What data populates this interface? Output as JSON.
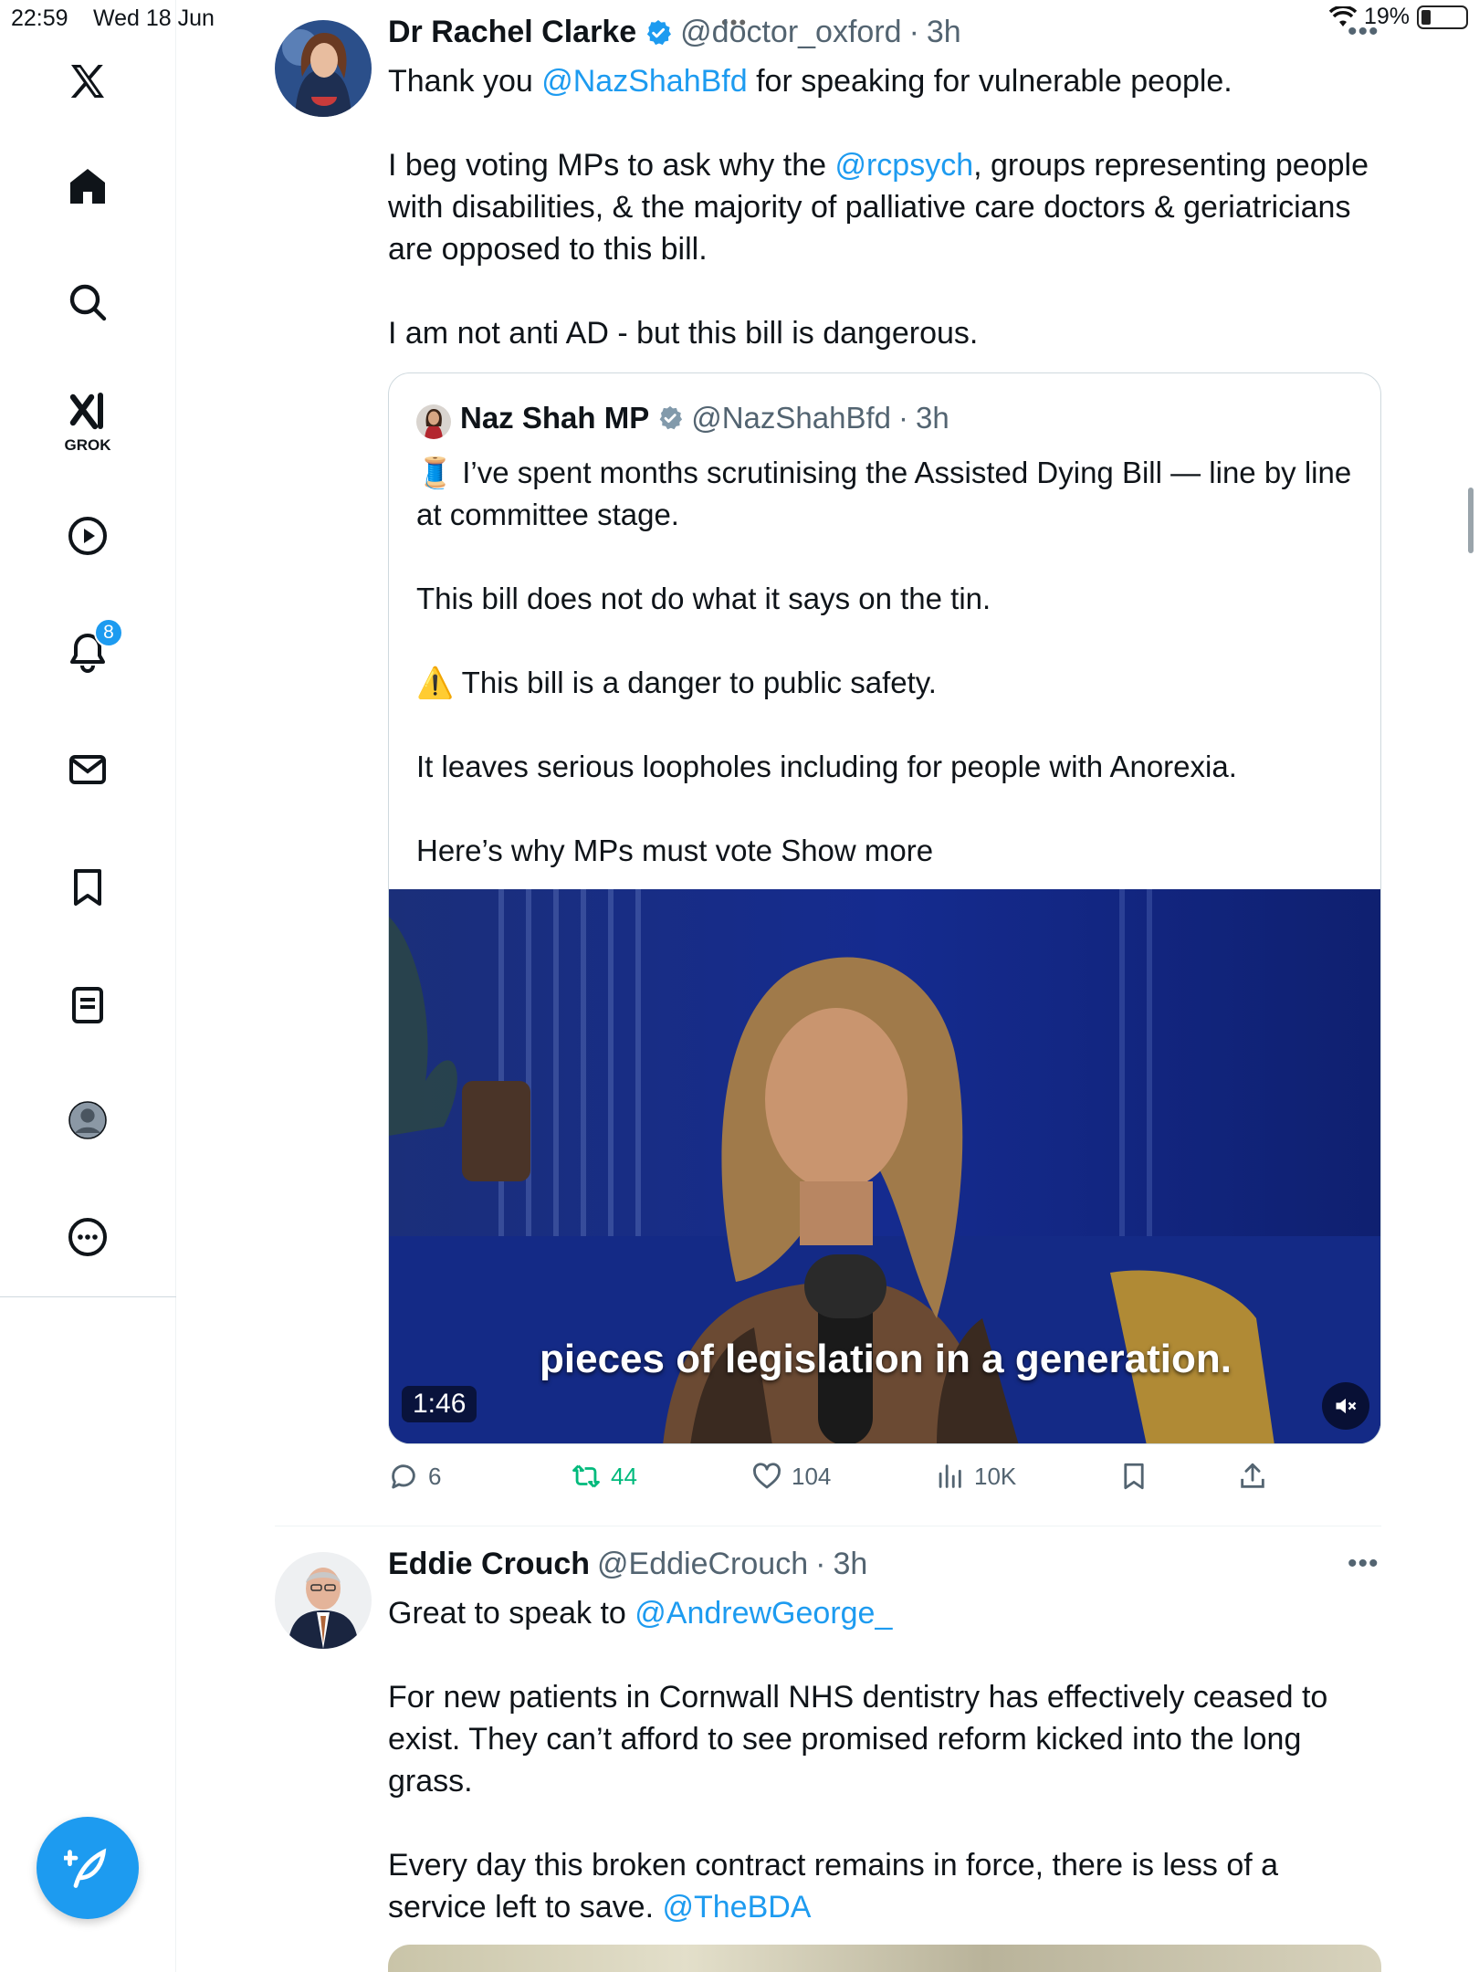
{
  "status_bar": {
    "time": "22:59",
    "date": "Wed 18 Jun",
    "battery": "19%"
  },
  "sidebar": {
    "items": [
      {
        "name": "x-logo"
      },
      {
        "name": "home"
      },
      {
        "name": "search"
      },
      {
        "name": "grok",
        "label": "GROK"
      },
      {
        "name": "video"
      },
      {
        "name": "notifications",
        "badge": "8"
      },
      {
        "name": "messages"
      },
      {
        "name": "bookmarks"
      },
      {
        "name": "lists"
      },
      {
        "name": "profile"
      },
      {
        "name": "more"
      }
    ]
  },
  "tweets": [
    {
      "name": "Dr Rachel Clarke",
      "handle": "@doctor_oxford",
      "time": "3h",
      "text": {
        "p1_pre": "Thank you ",
        "p1_link": "@NazShahBfd",
        "p1_post": " for speaking for vulnerable people.",
        "p2_pre": "I beg voting MPs to ask why the ",
        "p2_link": "@rcpsych",
        "p2_post": ", groups representing people with disabilities, & the majority of palliative care doctors & geriatricians are opposed to this bill.",
        "p3": "I am not anti AD - but this bill is dangerous."
      },
      "quote": {
        "name": "Naz Shah MP",
        "handle": "@NazShahBfd",
        "time": "3h",
        "p1": "🧵 I’ve spent months scrutinising the Assisted Dying Bill — line by line at committee stage.",
        "p2": "This bill does not do what it says on the tin.",
        "p3": "⚠️ This bill is a danger to public safety.",
        "p4": "It leaves serious loopholes including for people with Anorexia.",
        "p5": "Here’s why MPs must vote",
        "show_more": "Show more",
        "video_caption": "pieces of legislation in a generation.",
        "video_duration": "1:46"
      },
      "stats": {
        "replies": "6",
        "reposts": "44",
        "likes": "104",
        "views": "10K"
      }
    },
    {
      "name": "Eddie Crouch",
      "handle": "@EddieCrouch",
      "time": "3h",
      "text": {
        "p1_pre": "Great to speak to ",
        "p1_link": "@AndrewGeorge_",
        "p2": "For new patients in Cornwall NHS dentistry has effectively ceased to exist. They can’t afford to see promised reform kicked into the long grass.",
        "p3_pre": "Every day this broken contract remains in force, there is less of a service left to save. ",
        "p3_link": "@TheBDA"
      }
    }
  ],
  "colors": {
    "accent": "#1d9bf0",
    "repost": "#00ba7c",
    "secondary_text": "#536471"
  }
}
